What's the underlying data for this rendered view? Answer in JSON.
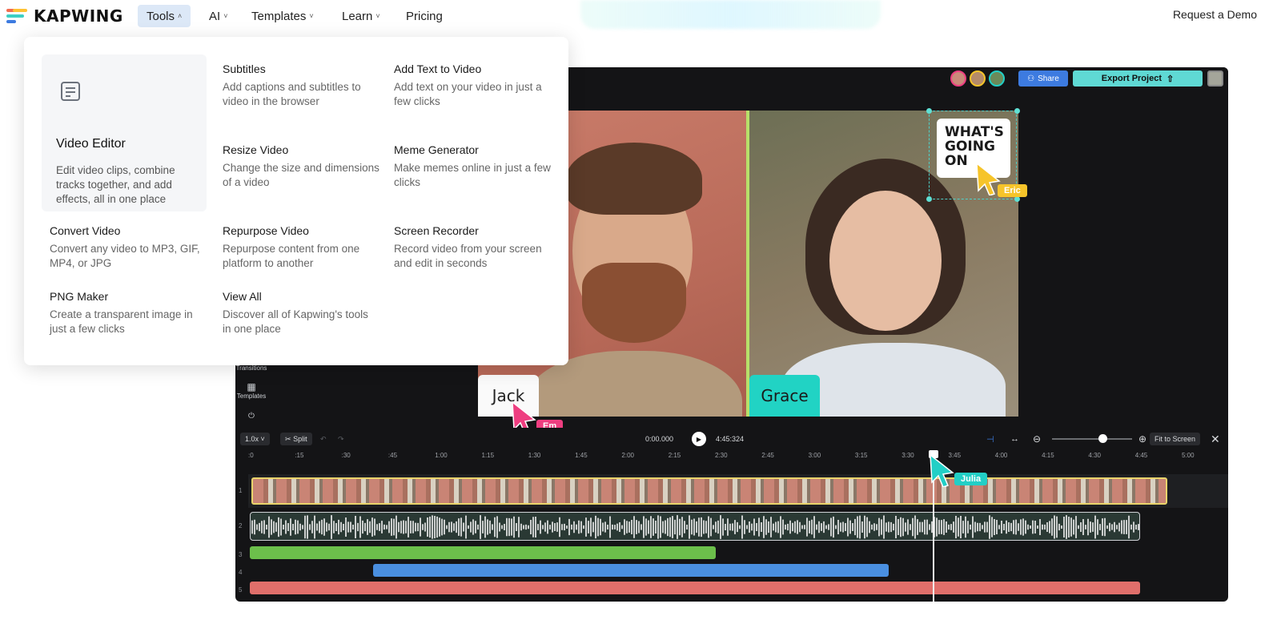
{
  "nav": {
    "brand": "KAPWING",
    "items": [
      {
        "label": "Tools",
        "caret": "˄"
      },
      {
        "label": "AI",
        "caret": "˅"
      },
      {
        "label": "Templates",
        "caret": "˅"
      },
      {
        "label": "Learn",
        "caret": "˅"
      },
      {
        "label": "Pricing",
        "caret": ""
      }
    ],
    "request_demo": "Request a Demo",
    "logo_colors": [
      "#f26c4f",
      "#ffc233",
      "#3ecfc4",
      "#3d7be0"
    ]
  },
  "menu": {
    "featured": {
      "title": "Video Editor",
      "desc": "Edit video clips, combine tracks together, and add effects, all in one place",
      "icon": "document-icon"
    },
    "items": [
      {
        "title": "Subtitles",
        "desc": "Add captions and subtitles to video in the browser"
      },
      {
        "title": "Add Text to Video",
        "desc": "Add text on your video in just a few clicks"
      },
      {
        "title": "Resize Video",
        "desc": "Change the size and dimensions of a video"
      },
      {
        "title": "Meme Generator",
        "desc": "Make memes online in just a few clicks"
      },
      {
        "title": "Convert Video",
        "desc": "Convert any video to MP3, GIF, MP4, or JPG"
      },
      {
        "title": "Repurpose Video",
        "desc": "Repurpose content from one platform to another"
      },
      {
        "title": "Screen Recorder",
        "desc": "Record video from your screen and edit in seconds"
      },
      {
        "title": "PNG Maker",
        "desc": "Create a transparent image in just a few clicks"
      },
      {
        "title": "View All",
        "desc": "Discover all of Kapwing's tools in one place"
      }
    ]
  },
  "editor": {
    "share_label": "Share",
    "export_label": "Export Project",
    "side_tools": [
      "Transitions",
      "Templates"
    ],
    "labels": {
      "jack": "Jack",
      "grace": "Grace"
    },
    "sticker_text": [
      "WHAT'S",
      "GOING",
      "ON"
    ],
    "cursors": {
      "em": "Em",
      "eric": "Eric",
      "julia": "Julia"
    },
    "colors": {
      "share": "#3d7be0",
      "export": "#5fd9d4",
      "em": "#ee3e80",
      "eric": "#f6c42a",
      "julia": "#22cfc6"
    }
  },
  "timeline": {
    "speed": "1.0x",
    "split": "Split",
    "time_current": "0:00.000",
    "time_total": "4:45:324",
    "fit": "Fit to Screen",
    "ticks": [
      ":0",
      ":15",
      ":30",
      ":45",
      "1:00",
      "1:15",
      "1:30",
      "1:45",
      "2:00",
      "2:15",
      "2:30",
      "2:45",
      "3:00",
      "3:15",
      "3:30",
      "3:45",
      "4:00",
      "4:15",
      "4:30",
      "4:45",
      "5:00"
    ],
    "track_numbers": [
      "1",
      "2",
      "3",
      "4",
      "5"
    ],
    "track_colors": {
      "green": "#6cbf4b",
      "blue": "#4a8fe0",
      "red": "#e06f6b"
    }
  }
}
